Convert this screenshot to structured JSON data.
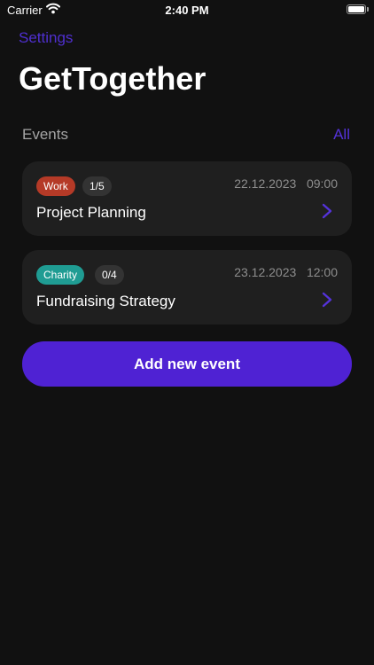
{
  "status_bar": {
    "carrier": "Carrier",
    "time": "2:40 PM"
  },
  "header": {
    "settings_label": "Settings",
    "title": "GetTogether"
  },
  "events_section": {
    "title": "Events",
    "all_label": "All"
  },
  "events": [
    {
      "category": "Work",
      "category_color": "#b53a27",
      "participants": "1/5",
      "date": "22.12.2023",
      "time": "09:00",
      "title": "Project Planning"
    },
    {
      "category": "Charity",
      "category_color": "#1f9c93",
      "participants": "0/4",
      "date": "23.12.2023",
      "time": "12:00",
      "title": "Fundraising Strategy"
    }
  ],
  "add_button": {
    "label": "Add new event"
  },
  "colors": {
    "accent": "#4f22d3",
    "background": "#111111",
    "card": "#1f1f1f"
  },
  "icons": {
    "wifi": "wifi-icon",
    "battery": "battery-icon",
    "chevron": "chevron-right-icon"
  }
}
